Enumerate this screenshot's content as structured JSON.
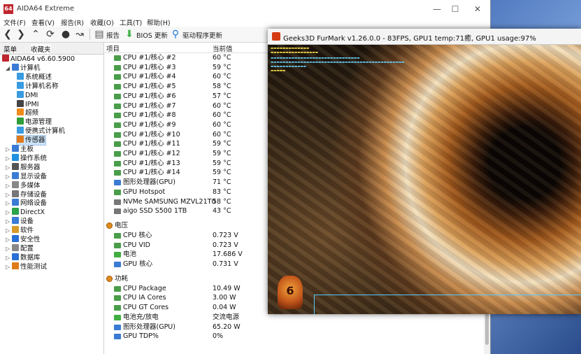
{
  "aida": {
    "title": "AIDA64 Extreme",
    "logo_text": "64",
    "menu": [
      "文件(F)",
      "查看(V)",
      "报告(R)",
      "收藏(O)",
      "工具(T)",
      "帮助(H)"
    ],
    "toolbar": {
      "report": "报告",
      "bios_update": "BIOS 更新",
      "driver_update": "驱动程序更新"
    },
    "tabs": {
      "menu": "菜单",
      "favorites": "收藏夹"
    },
    "tree": [
      {
        "label": "AIDA64 v6.60.5900",
        "level": 0,
        "color": "#c0262d"
      },
      {
        "label": "计算机",
        "level": 1,
        "color": "#3a7bd5",
        "expanded": true
      },
      {
        "label": "系统概述",
        "level": 2,
        "color": "#3a9be0"
      },
      {
        "label": "计算机名称",
        "level": 2,
        "color": "#3a9be0"
      },
      {
        "label": "DMI",
        "level": 2,
        "color": "#3a9be0"
      },
      {
        "label": "IPMI",
        "level": 2,
        "color": "#444444"
      },
      {
        "label": "超频",
        "level": 2,
        "color": "#f08a1a"
      },
      {
        "label": "电源管理",
        "level": 2,
        "color": "#2f9e3a"
      },
      {
        "label": "便携式计算机",
        "level": 2,
        "color": "#3a9be0"
      },
      {
        "label": "传感器",
        "level": 2,
        "color": "#e07a1a",
        "selected": true
      },
      {
        "label": "主板",
        "level": 1,
        "color": "#3a7bd5"
      },
      {
        "label": "操作系统",
        "level": 1,
        "color": "#1f8fe0"
      },
      {
        "label": "服务器",
        "level": 1,
        "color": "#555555"
      },
      {
        "label": "显示设备",
        "level": 1,
        "color": "#3a7bd5"
      },
      {
        "label": "多媒体",
        "level": 1,
        "color": "#888888"
      },
      {
        "label": "存储设备",
        "level": 1,
        "color": "#777777"
      },
      {
        "label": "网络设备",
        "level": 1,
        "color": "#3a7bd5"
      },
      {
        "label": "DirectX",
        "level": 1,
        "color": "#2aa34a"
      },
      {
        "label": "设备",
        "level": 1,
        "color": "#3a7bd5"
      },
      {
        "label": "软件",
        "level": 1,
        "color": "#d99a2a"
      },
      {
        "label": "安全性",
        "level": 1,
        "color": "#2b6fd6"
      },
      {
        "label": "配置",
        "level": 1,
        "color": "#888888"
      },
      {
        "label": "数据库",
        "level": 1,
        "color": "#2b6fd6"
      },
      {
        "label": "性能测试",
        "level": 1,
        "color": "#e07a1a"
      }
    ],
    "columns": {
      "item": "项目",
      "value": "当前值"
    },
    "rows": [
      {
        "name": "CPU #1/核心 #2",
        "value": "60 °C",
        "icon": "cpu"
      },
      {
        "name": "CPU #1/核心 #3",
        "value": "59 °C",
        "icon": "cpu"
      },
      {
        "name": "CPU #1/核心 #4",
        "value": "60 °C",
        "icon": "cpu"
      },
      {
        "name": "CPU #1/核心 #5",
        "value": "58 °C",
        "icon": "cpu"
      },
      {
        "name": "CPU #1/核心 #6",
        "value": "57 °C",
        "icon": "cpu"
      },
      {
        "name": "CPU #1/核心 #7",
        "value": "60 °C",
        "icon": "cpu"
      },
      {
        "name": "CPU #1/核心 #8",
        "value": "60 °C",
        "icon": "cpu"
      },
      {
        "name": "CPU #1/核心 #9",
        "value": "60 °C",
        "icon": "cpu"
      },
      {
        "name": "CPU #1/核心 #10",
        "value": "60 °C",
        "icon": "cpu"
      },
      {
        "name": "CPU #1/核心 #11",
        "value": "59 °C",
        "icon": "cpu"
      },
      {
        "name": "CPU #1/核心 #12",
        "value": "59 °C",
        "icon": "cpu"
      },
      {
        "name": "CPU #1/核心 #13",
        "value": "59 °C",
        "icon": "cpu"
      },
      {
        "name": "CPU #1/核心 #14",
        "value": "59 °C",
        "icon": "cpu"
      },
      {
        "name": "图形处理器(GPU)",
        "value": "71 °C",
        "icon": "gpu"
      },
      {
        "name": "GPU Hotspot",
        "value": "83 °C",
        "icon": "cpu"
      },
      {
        "name": "NVMe SAMSUNG MZVL21T0",
        "value": "58 °C",
        "icon": "disk"
      },
      {
        "name": "aigo SSD S500 1TB",
        "value": "43 °C",
        "icon": "disk"
      },
      {
        "section": "电压"
      },
      {
        "name": "CPU 核心",
        "value": "0.723 V",
        "icon": "cpu"
      },
      {
        "name": "CPU VID",
        "value": "0.723 V",
        "icon": "cpu"
      },
      {
        "name": "电池",
        "value": "17.686 V",
        "icon": "battery"
      },
      {
        "name": "GPU 核心",
        "value": "0.731 V",
        "icon": "gpu"
      },
      {
        "section": "功耗"
      },
      {
        "name": "CPU Package",
        "value": "10.49 W",
        "icon": "cpu"
      },
      {
        "name": "CPU IA Cores",
        "value": "3.00 W",
        "icon": "cpu"
      },
      {
        "name": "CPU GT Cores",
        "value": "0.04 W",
        "icon": "cpu"
      },
      {
        "name": "电池充/放电",
        "value": "交流电源",
        "icon": "battery"
      },
      {
        "name": "图形处理器(GPU)",
        "value": "65.20 W",
        "icon": "gpu"
      },
      {
        "name": "GPU TDP%",
        "value": "0%",
        "icon": "gpu"
      }
    ]
  },
  "furmark": {
    "title": "Geeks3D FurMark v1.26.0.0 - 83FPS, GPU1 temp:71癒, GPU1 usage:97%",
    "badge": "6"
  },
  "colors": {
    "accent": "#0078d7",
    "selection": "#cce4f7"
  }
}
